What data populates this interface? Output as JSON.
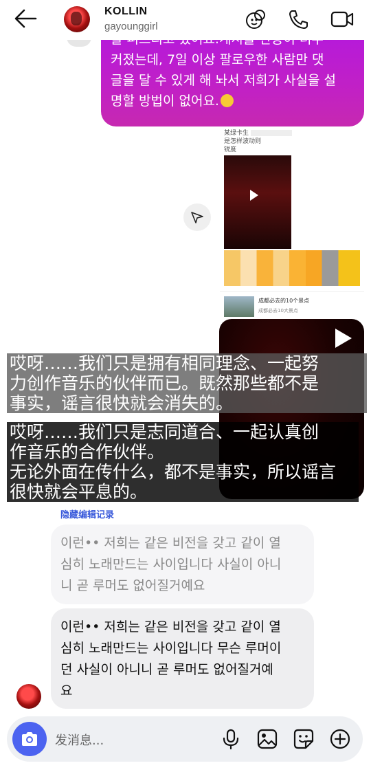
{
  "header": {
    "name": "KOLLIN",
    "username": "gayounggirl"
  },
  "messages": {
    "purple_partial": {
      "line1": "들 퍼뜨리고 있어요.게시물 반응이 너무",
      "line2": "커졌는데, 7일 이상 팔로우한 사람만 댓",
      "line3": "글을 달 수 있게 해 놔서 저희가 사실을 설",
      "line4": "명할 방법이 없어요."
    },
    "shared_card": {
      "head1": "某绿卡生",
      "head2": "是怎样波动则",
      "head3": "锐度",
      "ad_title": "成都必去的10个景点",
      "ad_sub": "成都必去10大景点"
    },
    "edit_history_label": "隐藏编辑记录",
    "old_message": {
      "line1": "이런•• 저희는 같은 비전을 갖고 같이 열",
      "line2": "심히 노래만드는 사이입니다 사실이 아니",
      "line3": "니 곧 루머도 없어질거예요"
    },
    "new_message": {
      "line1": "이런•• 저희는 같은 비전을 갖고 같이 열",
      "line2": "심히 노래만드는 사이입니다 무슨 루머이",
      "line3": "던 사실이 아니니 곧 루머도 없어질거예",
      "line4": "요"
    }
  },
  "subtitles": {
    "sub1": {
      "line1": "哎呀……我们只是拥有相同理念、一起努",
      "line2": "力创作音乐的伙伴而已。既然那些都不是",
      "line3": "事实，谣言很快就会消失的。"
    },
    "sub2": {
      "line1": "哎呀……我们只是志同道合、一起认真创",
      "line2": "作音乐的合作伙伴。",
      "line3": "无论外面在传什么，都不是事实，所以谣言",
      "line4": "很快就会平息的。"
    }
  },
  "composer": {
    "placeholder": "发消息..."
  },
  "icons": [
    "back-arrow-icon",
    "avatar",
    "video-game-icon",
    "phone-icon",
    "video-call-icon",
    "share-icon",
    "play-icon",
    "camera-icon",
    "microphone-icon",
    "image-icon",
    "sticker-icon",
    "plus-icon"
  ],
  "colors": {
    "purple_bubble": "#b61ad9",
    "accent_blue": "#4c63f0",
    "edit_link": "#3b5bdb",
    "bubble_gray": "#eeeef0"
  }
}
